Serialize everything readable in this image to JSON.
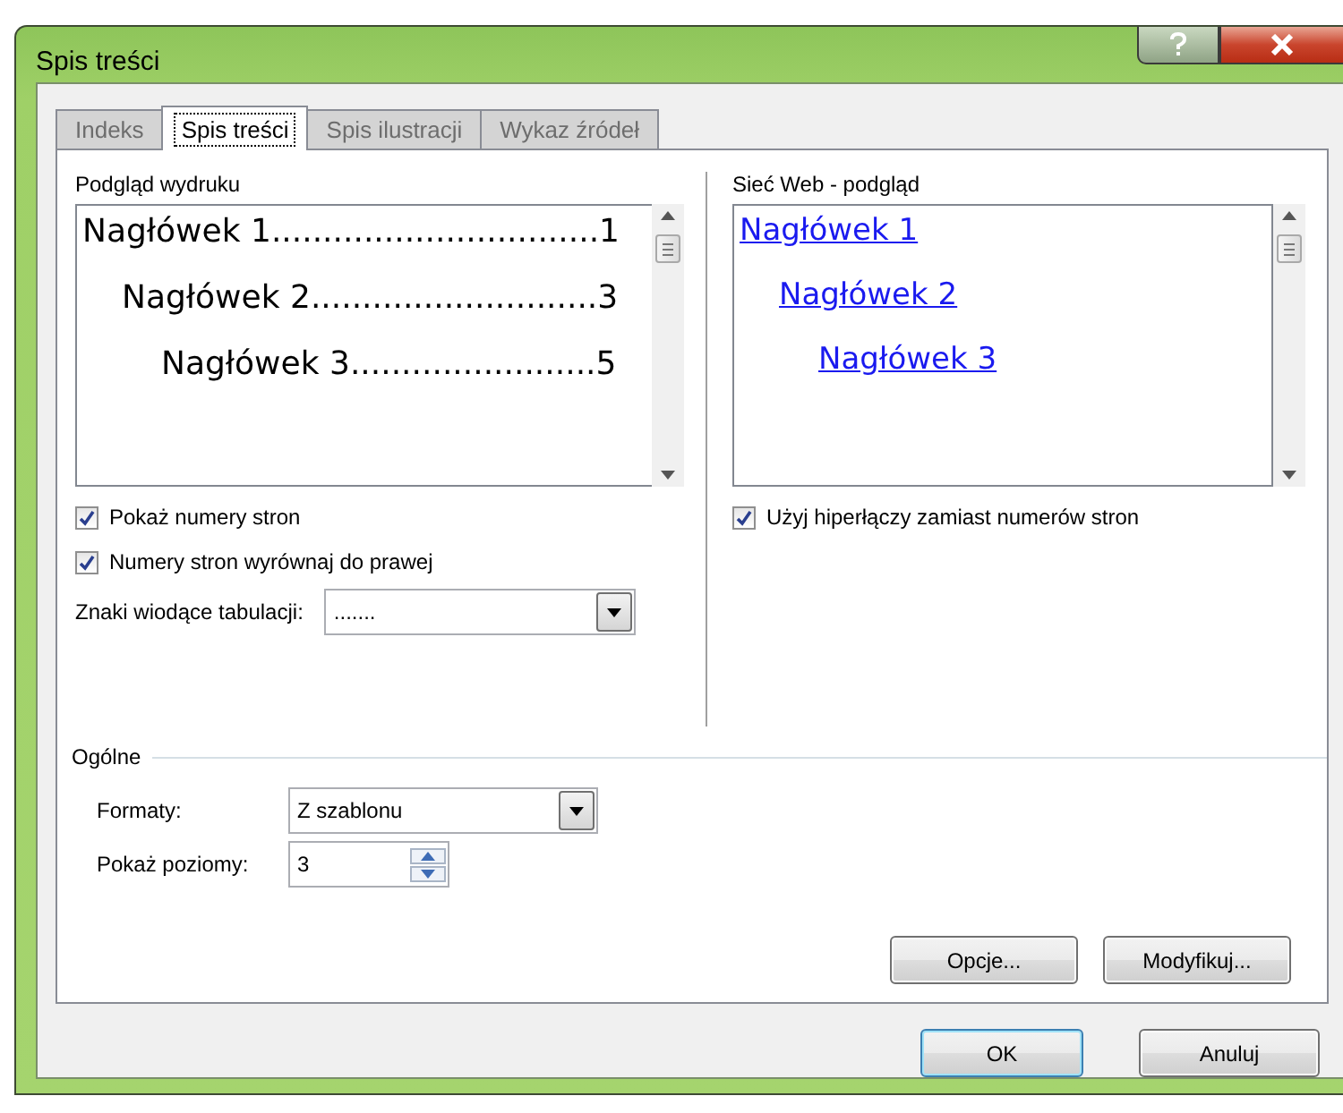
{
  "window": {
    "title": "Spis treści"
  },
  "tabs": [
    {
      "label": "Indeks",
      "selected": false
    },
    {
      "label": "Spis treści",
      "selected": true
    },
    {
      "label": "Spis ilustracji",
      "selected": false
    },
    {
      "label": "Wykaz źródeł",
      "selected": false
    }
  ],
  "print_preview": {
    "label": "Podgląd wydruku",
    "entries": [
      {
        "text": "Nagłówek 1",
        "leader": "................................",
        "page": "1",
        "children": [
          {
            "text": "Nagłówek 2",
            "leader": "............................",
            "page": "3",
            "children": [
              {
                "text": "Nagłówek 3",
                "leader": "........................",
                "page": "5"
              }
            ]
          }
        ]
      }
    ]
  },
  "print_options": [
    {
      "label": "Pokaż numery stron",
      "checked": true
    },
    {
      "label": "Numery stron wyrównaj do prawej",
      "checked": true
    }
  ],
  "tab_leader": {
    "label": "Znaki wiodące tabulacji:",
    "value": "......."
  },
  "web_preview": {
    "label": "Sieć Web - podgląd",
    "links": [
      {
        "text": "Nagłówek 1",
        "children": [
          {
            "text": "Nagłówek 2",
            "children": [
              {
                "text": "Nagłówek 3"
              }
            ]
          }
        ]
      }
    ]
  },
  "web_options": [
    {
      "label": "Użyj hiperłączy zamiast numerów stron",
      "checked": true
    }
  ],
  "general": {
    "title": "Ogólne",
    "formats": {
      "label": "Formaty:",
      "value": "Z szablonu"
    },
    "levels": {
      "label": "Pokaż poziomy:",
      "value": "3"
    }
  },
  "page_buttons": [
    "Opcje...",
    "Modyfikuj..."
  ],
  "dialog_buttons": [
    {
      "label": "OK",
      "default": true
    },
    {
      "label": "Anuluj",
      "default": false
    }
  ]
}
